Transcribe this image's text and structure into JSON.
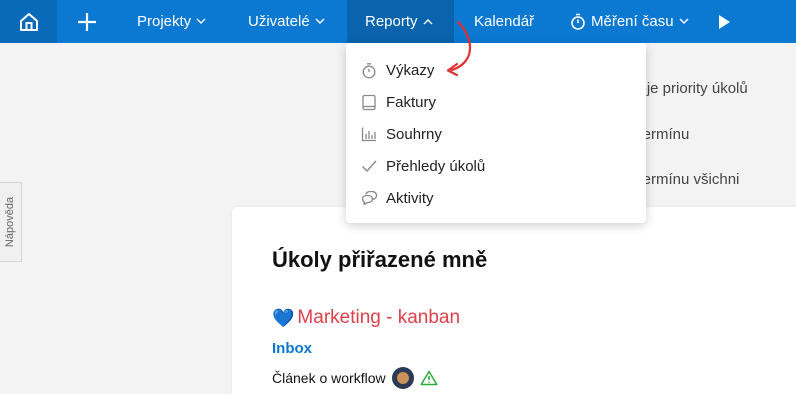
{
  "nav": {
    "home_icon": "home-icon",
    "add_icon": "plus-icon",
    "items": [
      {
        "label": "Projekty",
        "icon": "chevron-down-icon"
      },
      {
        "label": "Uživatelé",
        "icon": "chevron-down-icon"
      },
      {
        "label": "Reporty",
        "icon": "chevron-up-icon"
      },
      {
        "label": "Kalendář"
      },
      {
        "label": "Měření času",
        "icon": "stopwatch-icon"
      }
    ],
    "play_icon": "play-icon",
    "accent": "#0b78d1"
  },
  "reports_menu": {
    "items": [
      {
        "label": "Výkazy",
        "icon": "stopwatch-icon"
      },
      {
        "label": "Faktury",
        "icon": "book-icon"
      },
      {
        "label": "Souhrny",
        "icon": "bar-chart-icon"
      },
      {
        "label": "Přehledy úkolů",
        "icon": "check-icon"
      },
      {
        "label": "Aktivity",
        "icon": "chat-bubbles-icon"
      }
    ]
  },
  "help_tab": {
    "label": "Nápověda"
  },
  "filters": [
    {
      "label": "Moje priority úkolů"
    },
    {
      "label": "o termínu"
    },
    {
      "label": "o termínu všichni"
    }
  ],
  "card": {
    "title": "Úkoly přiřazené mně",
    "project": {
      "emoji": "💙",
      "name": "Marketing - kanban",
      "color": "#e0404a"
    },
    "section": "Inbox",
    "task": {
      "name": "Článek o workflow"
    }
  }
}
